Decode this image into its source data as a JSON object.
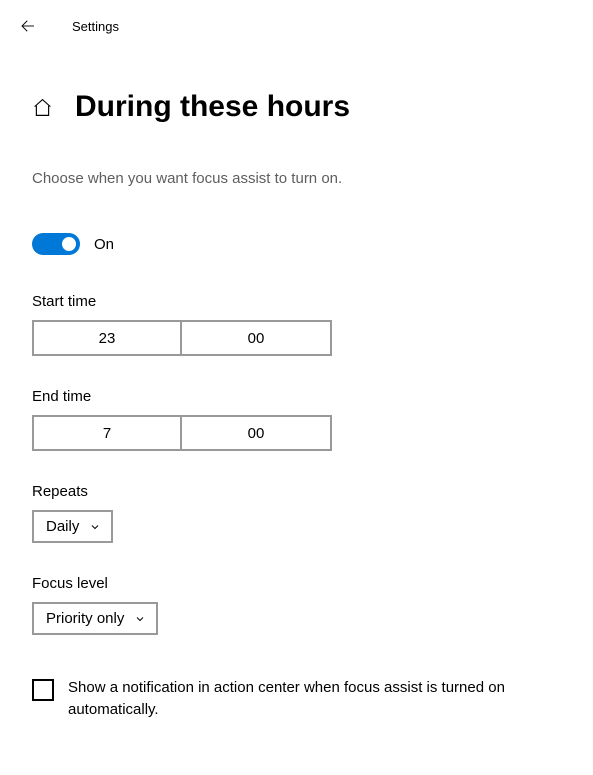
{
  "header": {
    "app_title": "Settings"
  },
  "page": {
    "title": "During these hours",
    "subtitle": "Choose when you want focus assist to turn on."
  },
  "toggle": {
    "state_label": "On",
    "on": true
  },
  "start_time": {
    "label": "Start time",
    "hour": "23",
    "minute": "00"
  },
  "end_time": {
    "label": "End time",
    "hour": "7",
    "minute": "00"
  },
  "repeats": {
    "label": "Repeats",
    "value": "Daily"
  },
  "focus_level": {
    "label": "Focus level",
    "value": "Priority only"
  },
  "notification_checkbox": {
    "label": "Show a notification in action center when focus assist is turned on automatically.",
    "checked": false
  }
}
